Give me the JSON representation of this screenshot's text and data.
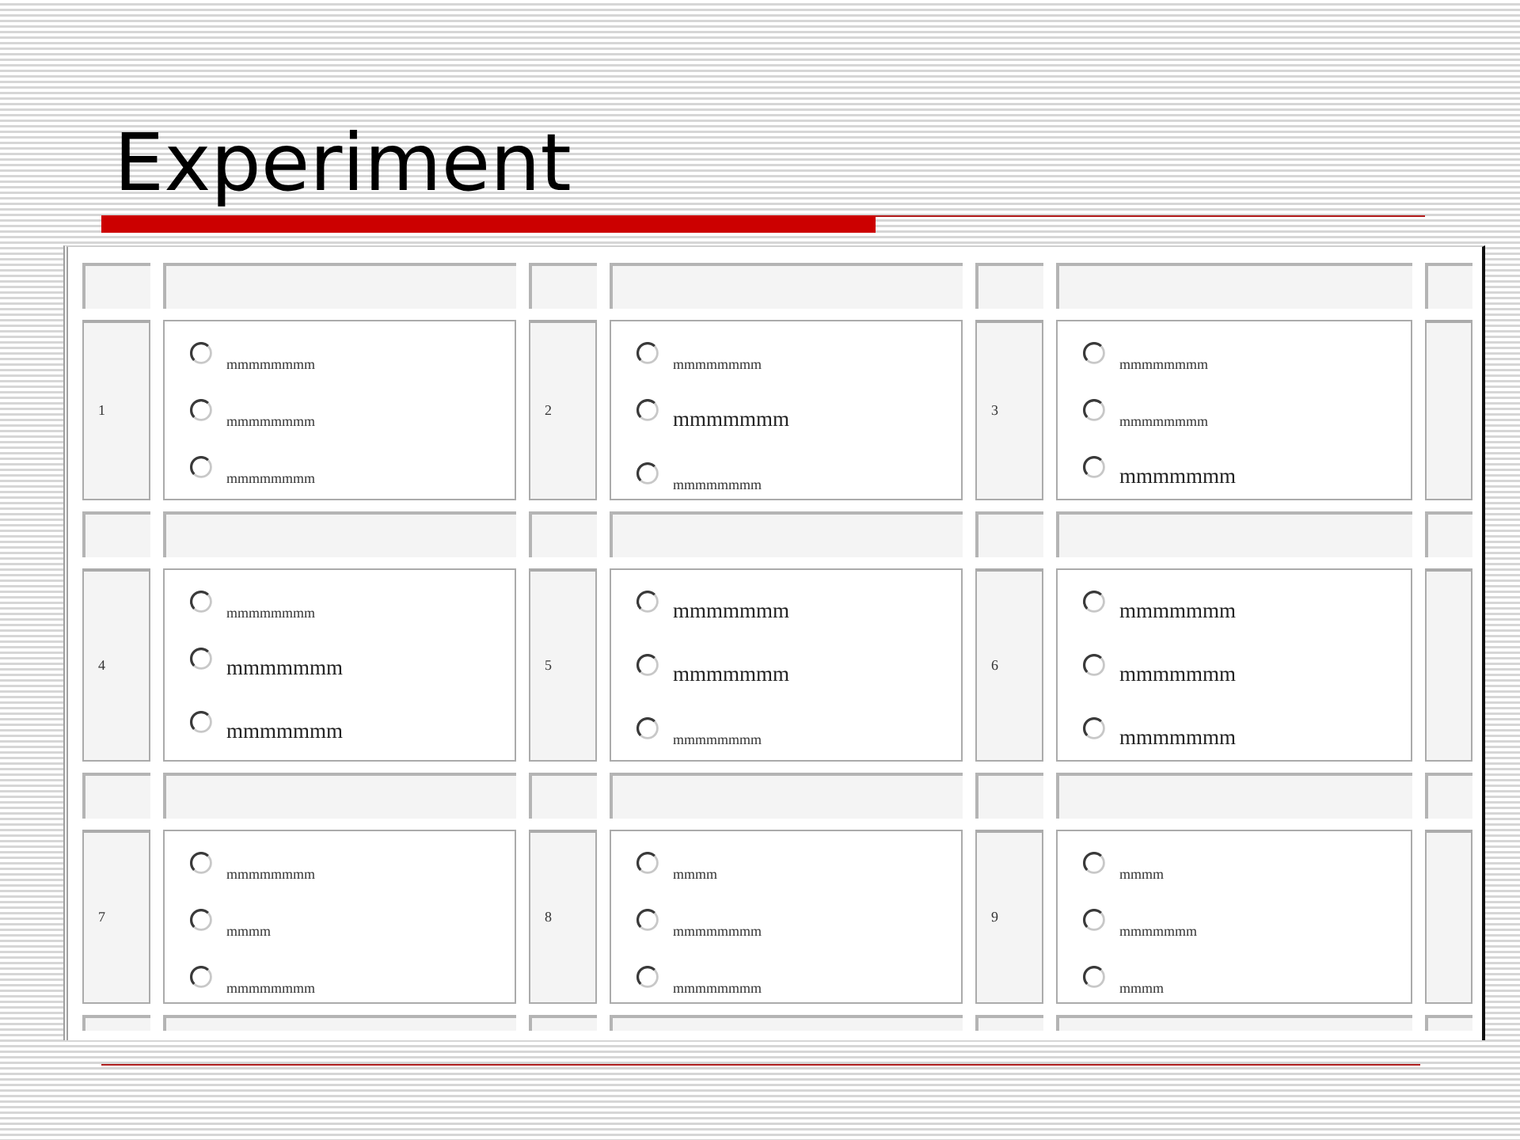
{
  "slide": {
    "title": "Experiment"
  },
  "form": {
    "questions": [
      {
        "number": "1",
        "options": [
          {
            "label": "mmmmmmmm",
            "kind": "small",
            "selected": false
          },
          {
            "label": "mmmmmmmm",
            "kind": "small",
            "selected": false
          },
          {
            "label": "mmmmmmmm",
            "kind": "small",
            "selected": false
          }
        ]
      },
      {
        "number": "2",
        "options": [
          {
            "label": "mmmmmmmm",
            "kind": "small",
            "selected": false
          },
          {
            "label": "mmmmmmm",
            "kind": "large",
            "selected": false
          },
          {
            "label": "mmmmmmmm",
            "kind": "small",
            "selected": false
          }
        ]
      },
      {
        "number": "3",
        "options": [
          {
            "label": "mmmmmmmm",
            "kind": "small",
            "selected": false
          },
          {
            "label": "mmmmmmmm",
            "kind": "small",
            "selected": false
          },
          {
            "label": "mmmmmmm",
            "kind": "large",
            "selected": false
          }
        ]
      },
      {
        "number": "4",
        "options": [
          {
            "label": "mmmmmmmm",
            "kind": "small",
            "selected": false
          },
          {
            "label": "mmmmmmm",
            "kind": "large",
            "selected": false
          },
          {
            "label": "mmmmmmm",
            "kind": "large",
            "selected": false
          }
        ]
      },
      {
        "number": "5",
        "options": [
          {
            "label": "mmmmmmm",
            "kind": "large",
            "selected": false
          },
          {
            "label": "mmmmmmm",
            "kind": "large",
            "selected": false
          },
          {
            "label": "mmmmmmmm",
            "kind": "small",
            "selected": false
          }
        ]
      },
      {
        "number": "6",
        "options": [
          {
            "label": "mmmmmmm",
            "kind": "large",
            "selected": false
          },
          {
            "label": "mmmmmmm",
            "kind": "large",
            "selected": false
          },
          {
            "label": "mmmmmmm",
            "kind": "large",
            "selected": false
          }
        ]
      },
      {
        "number": "7",
        "options": [
          {
            "label": "mmmmmmmm",
            "kind": "small",
            "selected": false
          },
          {
            "label": "mmmm",
            "kind": "small",
            "selected": false
          },
          {
            "label": "mmmmmmmm",
            "kind": "small",
            "selected": false
          }
        ]
      },
      {
        "number": "8",
        "options": [
          {
            "label": "mmmm",
            "kind": "small",
            "selected": false
          },
          {
            "label": "mmmmmmmm",
            "kind": "small",
            "selected": false
          },
          {
            "label": "mmmmmmmm",
            "kind": "small",
            "selected": false
          }
        ]
      },
      {
        "number": "9",
        "options": [
          {
            "label": "mmmm",
            "kind": "small",
            "selected": false
          },
          {
            "label": "mmmmmmm",
            "kind": "small",
            "selected": false
          },
          {
            "label": "mmmm",
            "kind": "small",
            "selected": false
          }
        ]
      }
    ]
  }
}
